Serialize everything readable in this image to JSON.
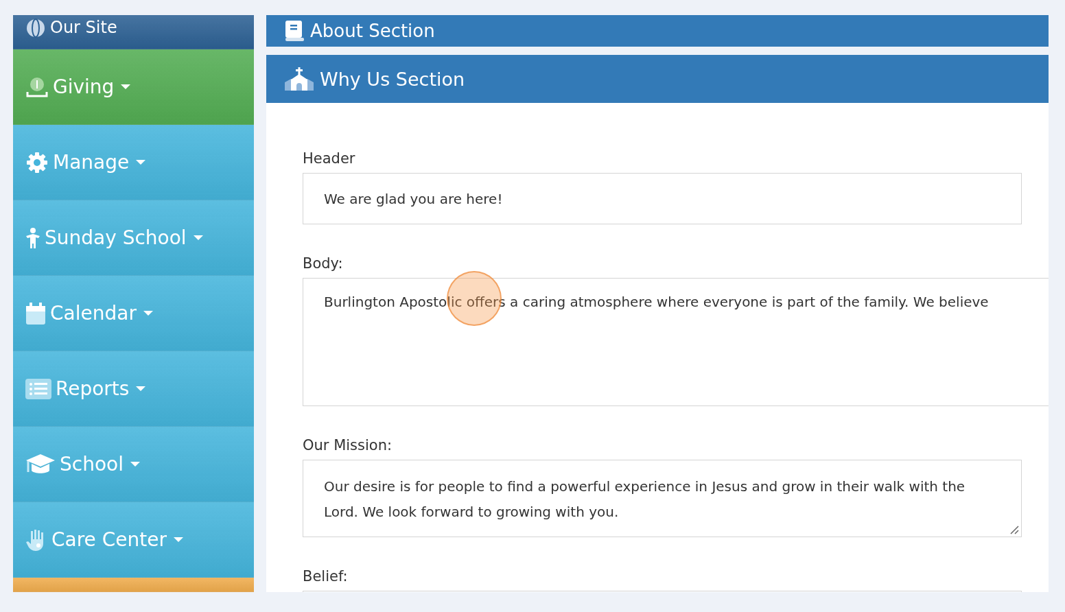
{
  "sidebar": {
    "items": [
      {
        "label": "Our Site",
        "color": "#2d6194",
        "caret": false
      },
      {
        "label": "Giving",
        "color": "#53ad53",
        "caret": true
      },
      {
        "label": "Manage",
        "color": "#45b5dc",
        "caret": true
      },
      {
        "label": "Sunday School",
        "color": "#45b5dc",
        "caret": true
      },
      {
        "label": "Calendar",
        "color": "#45b5dc",
        "caret": true
      },
      {
        "label": "Reports",
        "color": "#45b5dc",
        "caret": true
      },
      {
        "label": "School",
        "color": "#45b5dc",
        "caret": true
      },
      {
        "label": "Care Center",
        "color": "#45b5dc",
        "caret": true
      },
      {
        "color": "#f0ad4e",
        "caret": false
      }
    ]
  },
  "sections": [
    {
      "title": "About Section"
    },
    {
      "title": "Why Us Section"
    }
  ],
  "form": {
    "fields": [
      {
        "label": "Header",
        "value": "We are glad you are here!",
        "kind": "input"
      },
      {
        "label": "Body:",
        "value": "Burlington Apostolic offers a caring atmosphere where everyone is part of the family. We believe",
        "kind": "wide"
      },
      {
        "label": "Our Mission:",
        "value": "Our desire is for people to find a powerful experience in Jesus and grow in their walk with the Lord. We look forward to growing with you.",
        "kind": "textarea"
      },
      {
        "label": "Belief:",
        "kind": "input"
      }
    ]
  }
}
